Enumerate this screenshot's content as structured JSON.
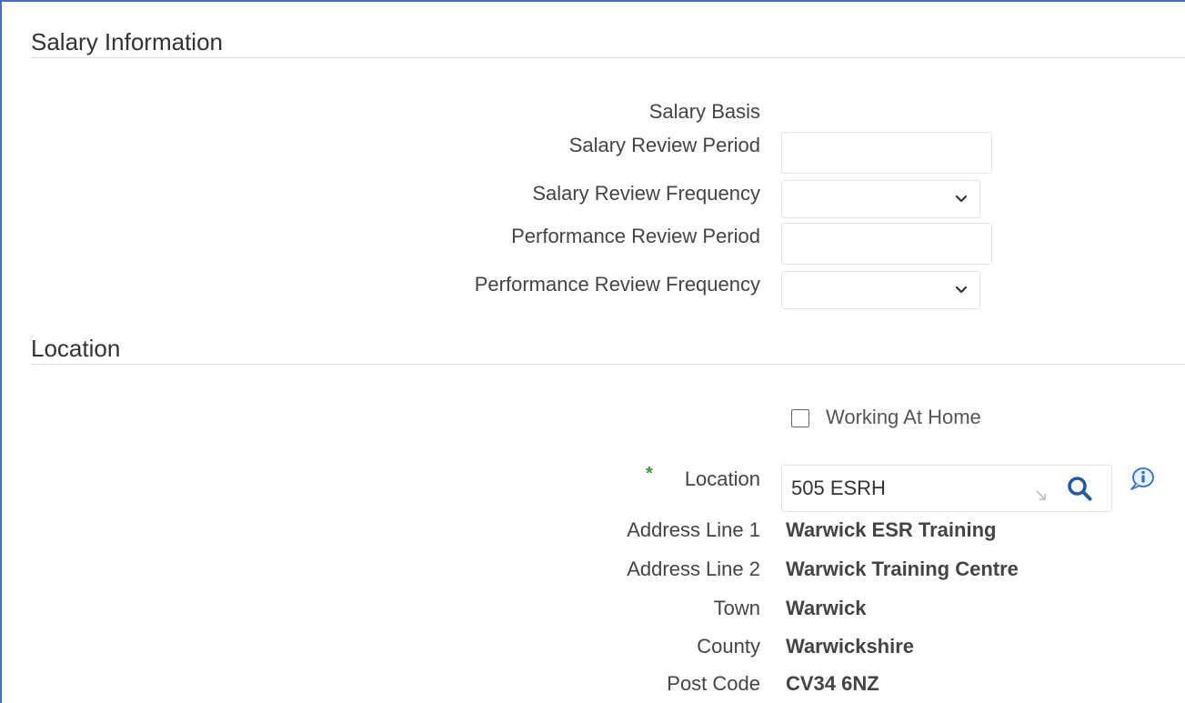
{
  "salary_section": {
    "title": "Salary Information",
    "salary_basis_label": "Salary Basis",
    "salary_review_period_label": "Salary Review Period",
    "salary_review_period_value": "",
    "salary_review_frequency_label": "Salary Review Frequency",
    "salary_review_frequency_value": "",
    "performance_review_period_label": "Performance Review Period",
    "performance_review_period_value": "",
    "performance_review_frequency_label": "Performance Review Frequency",
    "performance_review_frequency_value": ""
  },
  "location_section": {
    "title": "Location",
    "working_at_home_label": "Working At Home",
    "working_at_home_checked": false,
    "required_marker": "*",
    "location_label": "Location",
    "location_value": "505 ESRH",
    "address_line_1_label": "Address Line 1",
    "address_line_1_value": "Warwick ESR Training",
    "address_line_2_label": "Address Line 2",
    "address_line_2_value": "Warwick Training Centre",
    "town_label": "Town",
    "town_value": "Warwick",
    "county_label": "County",
    "county_value": "Warwickshire",
    "post_code_label": "Post Code",
    "post_code_value": "CV34 6NZ"
  },
  "icons": {
    "select_chevron": "chevron-down-icon",
    "lov_search": "search-icon",
    "lov_resize": "resize-corner-icon",
    "info": "info-icon"
  },
  "colors": {
    "frame_border": "#4a6fb5",
    "required_star": "#3a9b3a",
    "search_icon": "#1f5aa6",
    "info_icon": "#2a6fc9"
  }
}
